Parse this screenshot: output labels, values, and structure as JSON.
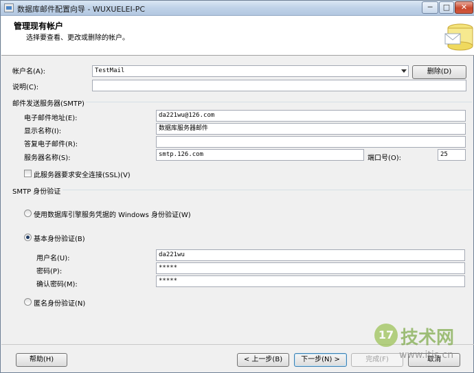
{
  "window": {
    "title": "数据库邮件配置向导 - WUXUELEI-PC",
    "min_glyph": "─",
    "max_glyph": "□",
    "close_glyph": "✕"
  },
  "header": {
    "title": "管理现有帐户",
    "subtitle": "选择要查看、更改或删除的帐户。"
  },
  "account": {
    "name_label": "帐户名(A):",
    "name_value": "TestMail",
    "delete_button": "删除(D)",
    "description_label": "说明(C):",
    "description_value": ""
  },
  "smtp": {
    "group_label": "邮件发送服务器(SMTP)",
    "email_label": "电子邮件地址(E):",
    "email_value": "da221wu@126.com",
    "display_name_label": "显示名称(I):",
    "display_name_value": "数据库服务器邮件",
    "reply_label": "答复电子邮件(R):",
    "reply_value": "",
    "server_label": "服务器名称(S):",
    "server_value": "smtp.126.com",
    "port_label": "端口号(O):",
    "port_value": "25",
    "ssl_label": "此服务器要求安全连接(SSL)(V)",
    "ssl_checked": false
  },
  "auth": {
    "group_label": "SMTP 身份验证",
    "windows_label": "使用数据库引擎服务凭据的 Windows 身份验证(W)",
    "basic_label": "基本身份验证(B)",
    "anonymous_label": "匿名身份验证(N)",
    "selected": "basic",
    "username_label": "用户名(U):",
    "username_value": "da221wu",
    "password_label": "密码(P):",
    "password_value": "*****",
    "confirm_label": "确认密码(M):",
    "confirm_value": "*****"
  },
  "footer": {
    "help_button": "帮助(H)",
    "back_button": "< 上一步(B)",
    "next_button": "下一步(N) >",
    "finish_button": "完成(F)",
    "cancel_button": "取消"
  },
  "watermark": {
    "logo_text": "17",
    "brand": "技术网",
    "url": "www.itjs.cn"
  },
  "colors": {
    "header_bg": "#ffffff",
    "dialog_bg": "#f0f0f0",
    "titlebar": "#bfd2e8",
    "close_button": "#c8472c"
  }
}
